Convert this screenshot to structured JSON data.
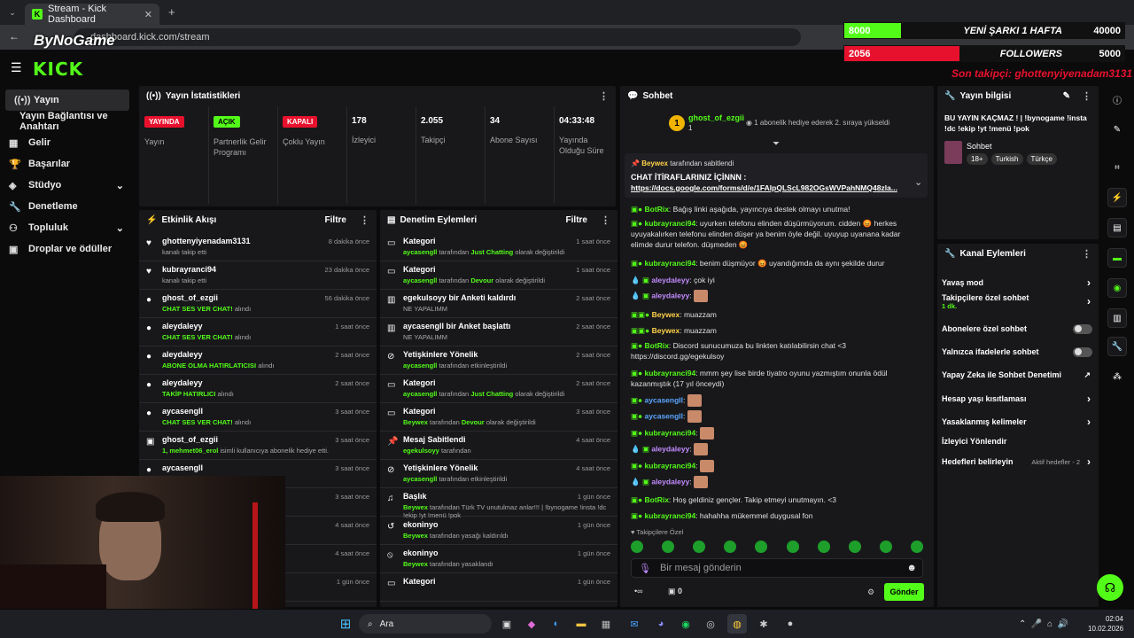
{
  "browser": {
    "tab_title": "Stream - Kick Dashboard",
    "url": "dashboard.kick.com/stream",
    "watermark": "ByNoGame"
  },
  "overlay": {
    "song": {
      "count": "8000",
      "label": "YENİ ŞARKI 1 HAFTA",
      "value": "40000",
      "progress": 0.2
    },
    "followers": {
      "count": "2056",
      "label": "FOLLOWERS",
      "value": "5000",
      "progress": 0.41
    },
    "last_follower": "Son takipçi: ghottenyiyenadam3131"
  },
  "sidebar": {
    "items": [
      {
        "label": "Yayın",
        "icon": "broadcast-icon"
      },
      {
        "label": "Yayın Bağlantısı ve Anahtarı",
        "icon": ""
      },
      {
        "label": "Gelir",
        "icon": "grid-icon"
      },
      {
        "label": "Başarılar",
        "icon": "trophy-icon"
      },
      {
        "label": "Stüdyo",
        "icon": "layers-icon"
      },
      {
        "label": "Denetleme",
        "icon": "wrench-icon"
      },
      {
        "label": "Topluluk",
        "icon": "users-icon"
      },
      {
        "label": "Droplar ve ödüller",
        "icon": "gift-icon"
      }
    ]
  },
  "stats": {
    "title": "Yayın İstatistikleri",
    "items": [
      {
        "badge": "YAYINDA",
        "label": "Yayın"
      },
      {
        "badge": "AÇIK",
        "label": "Partnerlik Gelir Programı"
      },
      {
        "badge": "KAPALI",
        "label": "Çoklu Yayın"
      },
      {
        "value": "178",
        "label": "İzleyici"
      },
      {
        "value": "2.055",
        "label": "Takipçi"
      },
      {
        "value": "34",
        "label": "Abone Sayısı"
      },
      {
        "value": "04:33:48",
        "label": "Yayında Olduğu Süre"
      }
    ]
  },
  "activity": {
    "title": "Etkinlik Akışı",
    "filter": "Filtre",
    "items": [
      {
        "user": "ghottenyiyenadam3131",
        "pre": "",
        "hl": "",
        "post": "kanalı takip etti",
        "time": "8 dakika önce"
      },
      {
        "user": "kubrayranci94",
        "pre": "",
        "hl": "",
        "post": "kanalı takip etti",
        "time": "23 dakika önce"
      },
      {
        "user": "ghost_of_ezgii",
        "pre": "",
        "hl": "CHAT SES VER CHAT!",
        "post": " alındı",
        "time": "56 dakika önce"
      },
      {
        "user": "aleydaleyy",
        "pre": "",
        "hl": "CHAT SES VER CHAT!",
        "post": " alındı",
        "time": "1 saat önce"
      },
      {
        "user": "aleydaleyy",
        "pre": "",
        "hl": "ABONE OLMA HATIRLATICISI",
        "post": " alındı",
        "time": "2 saat önce"
      },
      {
        "user": "aleydaleyy",
        "pre": "",
        "hl": "TAKİP HATIRLICI",
        "post": " alındı",
        "time": "2 saat önce"
      },
      {
        "user": "aycasengll",
        "pre": "",
        "hl": "CHAT SES VER CHAT!",
        "post": " alındı",
        "time": "3 saat önce"
      },
      {
        "user": "ghost_of_ezgii",
        "pre": "",
        "hl": "1, mehmet06_erol",
        "post": " isimli kullanıcıya abonelik hediye etti.",
        "time": "3 saat önce"
      },
      {
        "user": "aycasengll",
        "pre": "",
        "hl": "",
        "post": "",
        "time": "3 saat önce"
      },
      {
        "user": "",
        "pre": "",
        "hl": "",
        "post": "",
        "time": "3 saat önce"
      },
      {
        "user": "",
        "pre": "",
        "hl": "",
        "post": "",
        "time": "4 saat önce"
      },
      {
        "user": "",
        "pre": "",
        "hl": "",
        "post": "",
        "time": "4 saat önce"
      },
      {
        "user": "",
        "pre": "",
        "hl": "",
        "post": "",
        "time": "1 gün önce"
      }
    ]
  },
  "moderation": {
    "title": "Denetim Eylemleri",
    "filter": "Filtre",
    "items": [
      {
        "title": "Kategori",
        "a": "aycasengll",
        "b": " tarafından ",
        "c": "Just Chatting",
        "d": " olarak değiştirildi",
        "time": "1 saat önce",
        "icon": "tv-icon"
      },
      {
        "title": "Kategori",
        "a": "aycasengll",
        "b": " tarafından ",
        "c": "Devour",
        "d": " olarak değiştirildi",
        "time": "1 saat önce",
        "icon": "tv-icon"
      },
      {
        "title": "egekulsoyy bir Anketi kaldırdı",
        "a": "",
        "b": "NE YAPALIMM",
        "c": "",
        "d": "",
        "time": "2 saat önce",
        "icon": "poll-icon"
      },
      {
        "title": "aycasengll bir Anket başlattı",
        "a": "",
        "b": "NE YAPALIMM",
        "c": "",
        "d": "",
        "time": "2 saat önce",
        "icon": "poll-icon"
      },
      {
        "title": "Yetişkinlere Yönelik",
        "a": "aycasengll",
        "b": " tarafından etkinleştirildi",
        "c": "",
        "d": "",
        "time": "2 saat önce",
        "icon": "eye-off-icon"
      },
      {
        "title": "Kategori",
        "a": "aycasengll",
        "b": " tarafından ",
        "c": "Just Chatting",
        "d": " olarak değiştirildi",
        "time": "2 saat önce",
        "icon": "tv-icon"
      },
      {
        "title": "Kategori",
        "a": "Beywex",
        "b": " tarafından ",
        "c": "Devour",
        "d": " olarak değiştirildi",
        "time": "3 saat önce",
        "icon": "tv-icon"
      },
      {
        "title": "Mesaj Sabitlendi",
        "a": "egekulsoyy",
        "b": " tarafından",
        "c": "",
        "d": "",
        "time": "4 saat önce",
        "icon": "pin-icon"
      },
      {
        "title": "Yetişkinlere Yönelik",
        "a": "aycasengll",
        "b": " tarafından etkinleştirildi",
        "c": "",
        "d": "",
        "time": "4 saat önce",
        "icon": "eye-off-icon"
      },
      {
        "title": "Başlık",
        "a": "Beywex",
        "b": " tarafından ",
        "c": "",
        "d": "Türk TV unutulmaz anlar!!! | !bynogame !insta !dc !ekip !yt !menü !pok",
        "time": "1 gün önce",
        "icon": "text-icon"
      },
      {
        "title": "ekoninyo",
        "a": "Beywex",
        "b": " tarafından yasağı kaldırıldı",
        "c": "",
        "d": "",
        "time": "1 gün önce",
        "icon": "undo-icon"
      },
      {
        "title": "ekoninyo",
        "a": "Beywex",
        "b": " tarafından yasaklandı",
        "c": "",
        "d": "",
        "time": "1 gün önce",
        "icon": "ban-icon"
      },
      {
        "title": "Kategori",
        "a": "",
        "b": "",
        "c": "",
        "d": "",
        "time": "1 gün önce",
        "icon": "tv-icon"
      }
    ]
  },
  "chat": {
    "title": "Sohbet",
    "gift_user": "ghost_of_ezgii",
    "gift_count": "1",
    "gift_text": "1 abonelik hediye ederek 2. sıraya yükseldi",
    "pinned_by": "Beywex",
    "pinned_suffix": "tarafından sabitlendi",
    "pinned_text": "CHAT İTİRAFLARINIZ İÇİNNN :",
    "pinned_link": "https://docs.google.com/forms/d/e/1FAIpQLScL982OGsWVPahNMQ48zla...",
    "messages": [
      {
        "user": "BotRix",
        "color": "green",
        "text": "Bağış linki aşağıda, yayıncıya destek olmayı unutma!"
      },
      {
        "user": "kubrayranci94",
        "color": "green",
        "text": "uyurken telefonu elinden düşürmüyorum. cidden 😡 herkes uyuyakalırken telefonu elinden düşer ya benim öyle değil. uyuyup uyanana kadar elimde durur telefon. düşmeden 😡"
      },
      {
        "user": "kubrayranci94",
        "color": "green",
        "text": "benim düşmüyor 😡 uyandığımda da aynı şekilde durur"
      },
      {
        "user": "aleydaleyy",
        "color": "purple",
        "text": "çok iyi"
      },
      {
        "user": "aleydaleyy",
        "color": "purple",
        "text": ""
      },
      {
        "user": "Beywex",
        "color": "yel",
        "text": "muazzam"
      },
      {
        "user": "Beywex",
        "color": "yel",
        "text": "muazzam"
      },
      {
        "user": "BotRix",
        "color": "green",
        "text": "Discord sunucumuza bu linkten katılabilirsin chat <3 https://discord.gg/egekulsoy"
      },
      {
        "user": "kubrayranci94",
        "color": "green",
        "text": "mmm şey lise birde tiyatro oyunu yazmıştım onunla ödül kazanmıştık (17 yıl önceydi)"
      },
      {
        "user": "aycasengll",
        "color": "blue",
        "text": ""
      },
      {
        "user": "aycasengll",
        "color": "blue",
        "text": ""
      },
      {
        "user": "kubrayranci94",
        "color": "green",
        "text": ""
      },
      {
        "user": "aleydaleyy",
        "color": "purple",
        "text": ""
      },
      {
        "user": "kubrayranci94",
        "color": "green",
        "text": ""
      },
      {
        "user": "aleydaleyy",
        "color": "purple",
        "text": ""
      },
      {
        "user": "BotRix",
        "color": "green",
        "text": "Hoş geldiniz gençler. Takip etmeyi unutmayın. <3"
      },
      {
        "user": "kubrayranci94",
        "color": "green",
        "text": "hahahha mükemmel duygusal fon"
      }
    ],
    "followers_only": "Takipçilere Özel",
    "input_placeholder": "Bir mesaj gönderin",
    "points": "0",
    "send": "Gönder"
  },
  "stream_info": {
    "title": "Yayın bilgisi",
    "stream_title": "BU YAYIN KAÇMAZ ! | !bynogame !insta !dc !ekip !yt !menü !pok",
    "category": "Sohbet",
    "tags": [
      "18+",
      "Turkish",
      "Türkçe"
    ]
  },
  "channel_actions": {
    "title": "Kanal Eylemleri",
    "items": [
      {
        "label": "Yavaş mod",
        "sub": "",
        "ctrl": "chevron"
      },
      {
        "label": "Takipçilere özel sohbet",
        "sub": "1 dk.",
        "ctrl": "chevron"
      },
      {
        "label": "Abonelere özel sohbet",
        "sub": "",
        "ctrl": "toggle"
      },
      {
        "label": "Yalnızca ifadelerle sohbet",
        "sub": "",
        "ctrl": "toggle"
      },
      {
        "label": "Yapay Zeka ile Sohbet Denetimi",
        "sub": "",
        "ctrl": "external"
      },
      {
        "label": "Hesap yaşı kısıtlaması",
        "sub": "",
        "ctrl": "chevron"
      },
      {
        "label": "Yasaklanmış kelimeler",
        "sub": "",
        "ctrl": "chevron"
      },
      {
        "label": "İzleyici Yönlendir",
        "sub": "",
        "ctrl": ""
      },
      {
        "label": "Hedefleri belirleyin",
        "sub": "Aktif hedefler - 2",
        "ctrl": "chevron"
      }
    ]
  },
  "taskbar": {
    "search": "Ara",
    "time": "02:04",
    "date": "10.02.2026"
  },
  "colors": {
    "accent": "#53fc18",
    "panel": "#18181b",
    "live": "#e8112d"
  }
}
